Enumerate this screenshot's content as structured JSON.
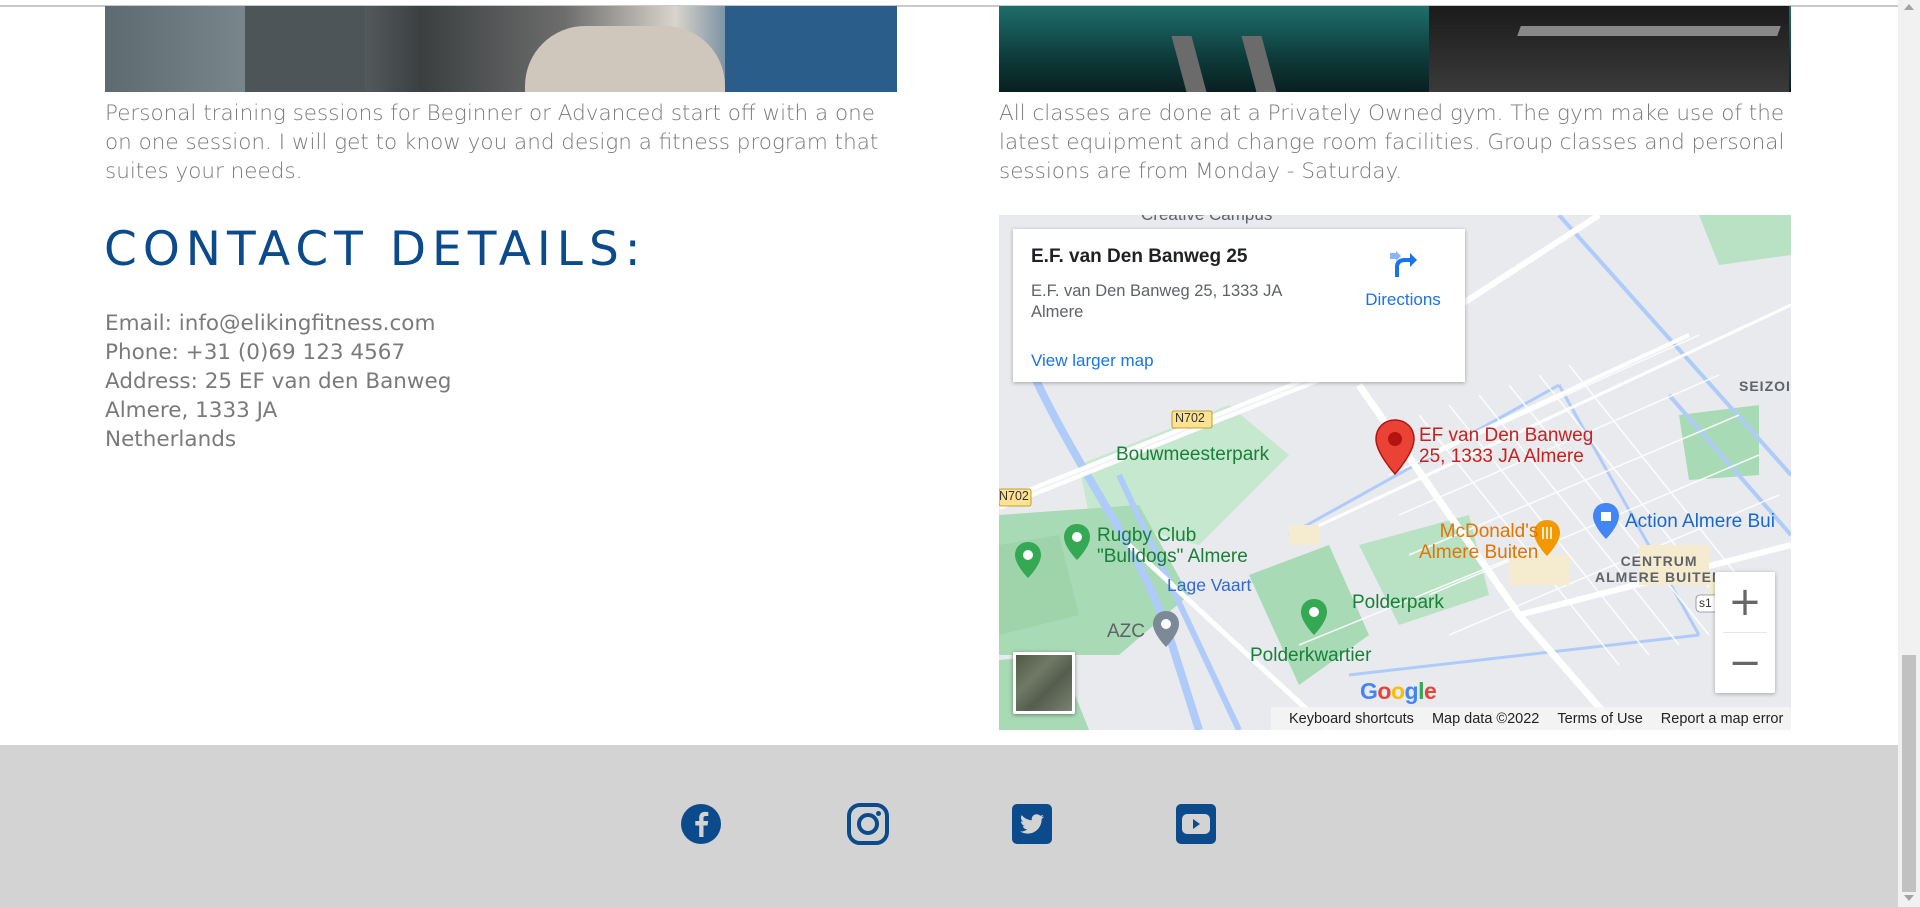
{
  "left_column": {
    "description": "Personal training sessions for Beginner or Advanced start off with a one on one session. I will get to know you and design a fitness program that suites your needs."
  },
  "right_column": {
    "description": "All classes are done at a Privately Owned gym. The gym make use of the latest equipment and change room facilities. Group classes and personal sessions are from Monday - Saturday."
  },
  "contact": {
    "heading": "CONTACT DETAILS:",
    "email": "Email: info@elikingfitness.com",
    "phone": "Phone: +31 (0)69 123 4567",
    "address": "Address: 25 EF van den Banweg",
    "city": "Almere, 1333 JA",
    "country": "Netherlands"
  },
  "map": {
    "place_title": "E.F. van Den Banweg 25",
    "place_address": "E.F. van Den Banweg 25, 1333 JA Almere",
    "directions_label": "Directions",
    "view_larger_label": "View larger map",
    "pin_label_line1": "EF van Den Banweg",
    "pin_label_line2": "25, 1333 JA Almere",
    "labels": {
      "creative_campus": "Creative Campus",
      "road_n702_a": "N702",
      "road_n702_b": "N702",
      "bouwmeesterpark": "Bouwmeesterpark",
      "rugby_line1": "Rugby Club",
      "rugby_line2": "\"Bulldogs\" Almere",
      "lage_vaart": "Lage Vaart",
      "azc": "AZC",
      "polderpark": "Polderpark",
      "polderkwartier": "Polderkwartier",
      "mcdonalds_line1": "McDonald's",
      "mcdonalds_line2": "Almere Buiten",
      "action": "Action Almere Bui",
      "centrum_line1": "CENTRUM",
      "centrum_line2": "ALMERE BUITEN",
      "seizo": "SEIZOI",
      "road_s": "s1"
    },
    "zoom_in": "+",
    "zoom_out": "−",
    "footer": {
      "shortcuts": "Keyboard shortcuts",
      "map_data": "Map data ©2022",
      "terms": "Terms of Use",
      "report": "Report a map error"
    },
    "colors": {
      "pin": "#ea4335",
      "park": "#a8dab5",
      "water": "#aecbfa",
      "road": "#ffffff"
    }
  },
  "footer": {
    "social": [
      "facebook-icon",
      "instagram-icon",
      "twitter-icon",
      "youtube-icon"
    ],
    "icon_color": "#0b4a8b"
  }
}
